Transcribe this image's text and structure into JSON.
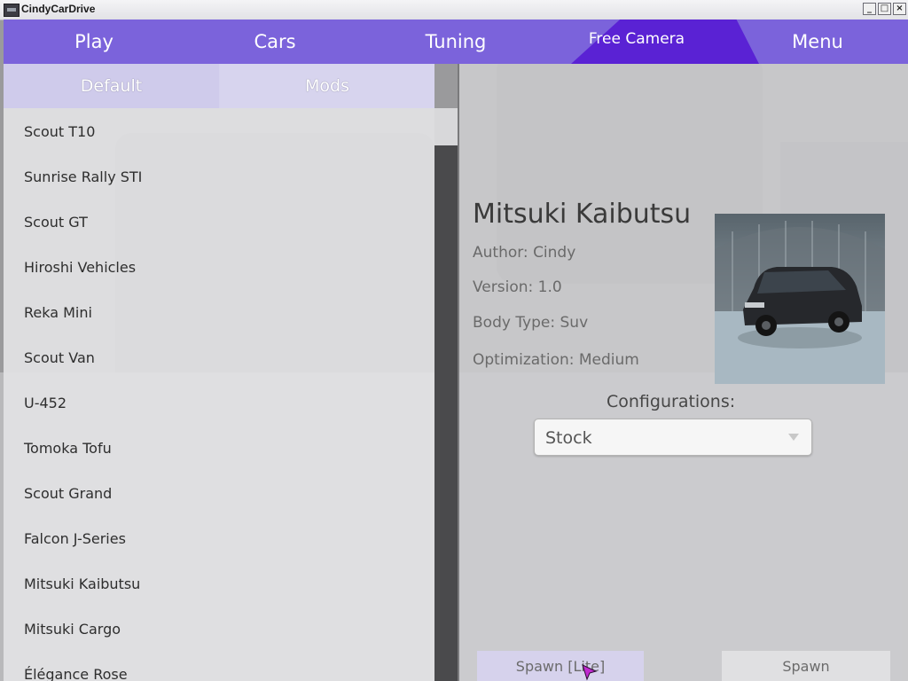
{
  "window": {
    "title": "CindyCarDrive",
    "minimize": "_",
    "maximize": "□",
    "close": "×"
  },
  "nav": {
    "tabs": [
      "Play",
      "Cars",
      "Tuning",
      "Free Camera",
      "Menu"
    ],
    "active_tab": "Free Camera"
  },
  "subtabs": {
    "default": "Default",
    "mods": "Mods"
  },
  "car_list": [
    "Scout T10",
    "Sunrise Rally STI",
    "Scout GT",
    "Hiroshi Vehicles",
    "Reka Mini",
    "Scout Van",
    "U-452",
    "Tomoka Tofu",
    "Scout Grand",
    "Falcon J-Series",
    "Mitsuki Kaibutsu",
    "Mitsuki Cargo",
    "Élégance Rose"
  ],
  "details": {
    "name": "Mitsuki Kaibutsu",
    "author": "Author: Cindy",
    "version": "Version: 1.0",
    "body_type": "Body Type: Suv",
    "optimization": "Optimization: Medium",
    "configurations_label": "Configurations:",
    "configuration_value": "Stock",
    "spawn_lite": "Spawn [Lite]",
    "spawn": "Spawn"
  },
  "colors": {
    "nav_bg": "#7b63db",
    "nav_active": "#5a22d4",
    "subtab_bg": "#d5d2ee",
    "scrollbar_track": "#4a4a4c"
  },
  "icons": {
    "app": "app-icon",
    "dropdown": "chevron-down-icon",
    "cursor": "mouse-cursor-icon"
  }
}
